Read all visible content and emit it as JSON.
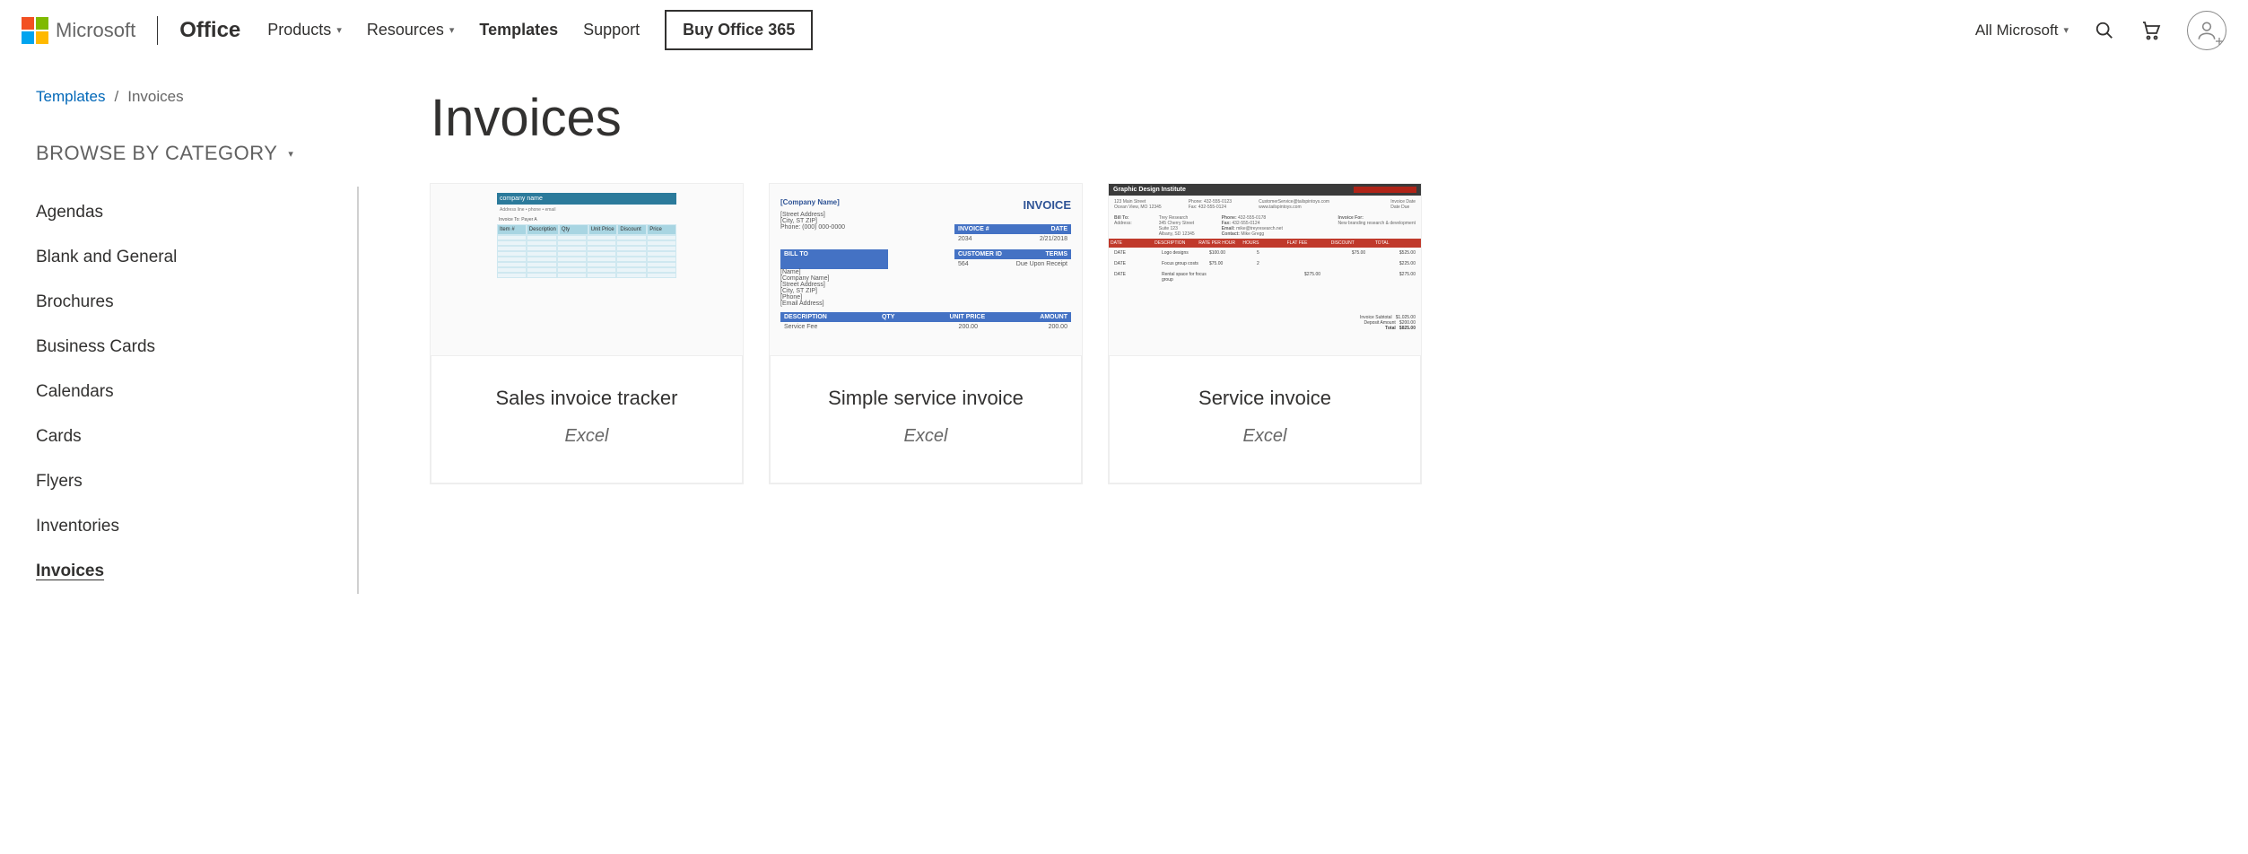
{
  "header": {
    "company": "Microsoft",
    "brand": "Office",
    "nav": {
      "products": "Products",
      "resources": "Resources",
      "templates": "Templates",
      "support": "Support",
      "buy": "Buy Office 365"
    },
    "allMicrosoft": "All Microsoft"
  },
  "breadcrumb": {
    "root": "Templates",
    "sep": "/",
    "current": "Invoices"
  },
  "sidebar": {
    "heading": "BROWSE BY CATEGORY",
    "items": [
      "Agendas",
      "Blank and General",
      "Brochures",
      "Business Cards",
      "Calendars",
      "Cards",
      "Flyers",
      "Inventories",
      "Invoices"
    ]
  },
  "page": {
    "title": "Invoices"
  },
  "cards": [
    {
      "title": "Sales invoice tracker",
      "app": "Excel"
    },
    {
      "title": "Simple service invoice",
      "app": "Excel"
    },
    {
      "title": "Service invoice",
      "app": "Excel"
    }
  ],
  "mock": {
    "inv": {
      "company": "[Company Name]",
      "street": "[Street Address]",
      "city": "[City, ST  ZIP]",
      "phone": "Phone: (000) 000-0000",
      "title": "INVOICE",
      "hInvNo": "INVOICE #",
      "hDate": "DATE",
      "invNo": "2034",
      "date": "2/21/2018",
      "billTo": "BILL TO",
      "custId": "CUSTOMER ID",
      "terms": "TERMS",
      "custIdV": "564",
      "termsV": "Due Upon Receipt",
      "name": "[Name]",
      "company2": "[Company Name]",
      "street2": "[Street Address]",
      "city2": "[City, ST  ZIP]",
      "phone2": "[Phone]",
      "email": "[Email Address]",
      "desc": "DESCRIPTION",
      "qty": "QTY",
      "unit": "UNIT PRICE",
      "amt": "AMOUNT",
      "item": "Service Fee",
      "v": "200.00"
    },
    "svc": {
      "title": "Graphic Design Institute"
    }
  }
}
